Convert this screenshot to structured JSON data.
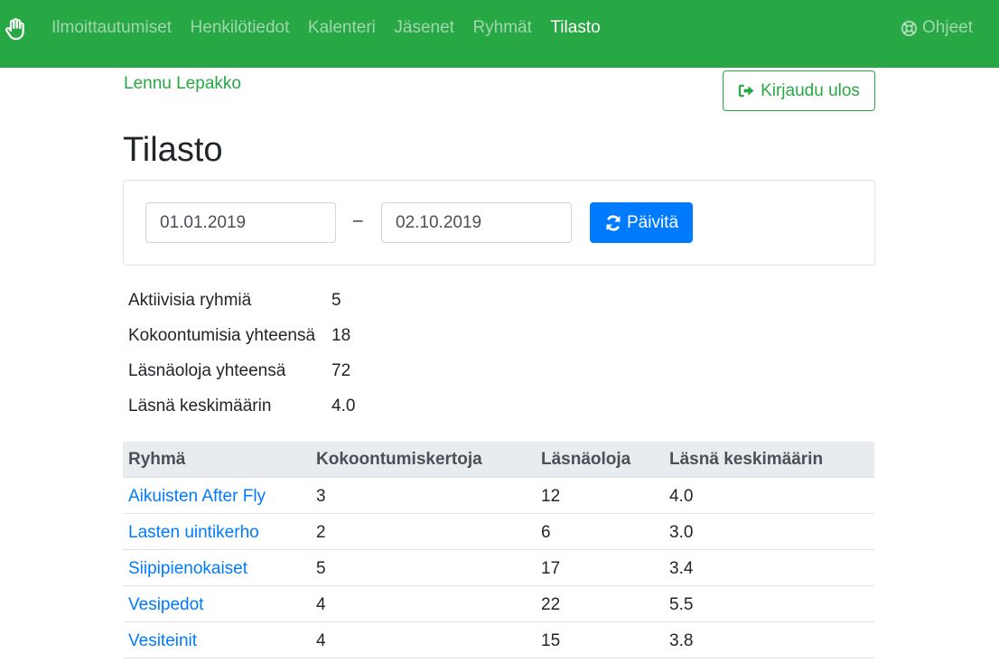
{
  "nav": {
    "brand_icon": "hand-icon",
    "items": [
      {
        "label": "Ilmoittautumiset"
      },
      {
        "label": "Henkilötiedot"
      },
      {
        "label": "Kalenteri"
      },
      {
        "label": "Jäsenet"
      },
      {
        "label": "Ryhmät"
      },
      {
        "label": "Tilasto"
      }
    ],
    "active": "Tilasto",
    "help_label": "Ohjeet",
    "help_icon": "lifebuoy-icon",
    "background_color": "#28a745"
  },
  "user": {
    "name": "Lennu Lepakko"
  },
  "logout": {
    "label": "Kirjaudu ulos",
    "icon": "sign-out-icon"
  },
  "page": {
    "title": "Tilasto"
  },
  "filter": {
    "date_from": "01.01.2019",
    "separator": "–",
    "date_to": "02.10.2019",
    "refresh_label": "Päivitä",
    "refresh_icon": "refresh-icon"
  },
  "summary": [
    {
      "label": "Aktiivisia ryhmiä",
      "value": "5"
    },
    {
      "label": "Kokoontumisia yhteensä",
      "value": "18"
    },
    {
      "label": "Läsnäoloja yhteensä",
      "value": "72"
    },
    {
      "label": "Läsnä keskimäärin",
      "value": "4.0"
    }
  ],
  "table": {
    "headers": [
      "Ryhmä",
      "Kokoontumiskertoja",
      "Läsnäoloja",
      "Läsnä keskimäärin"
    ],
    "rows": [
      [
        "Aikuisten After Fly",
        "3",
        "12",
        "4.0"
      ],
      [
        "Lasten uintikerho",
        "2",
        "6",
        "3.0"
      ],
      [
        "Siipipienokaiset",
        "5",
        "17",
        "3.4"
      ],
      [
        "Vesipedot",
        "4",
        "22",
        "5.5"
      ],
      [
        "Vesiteinit",
        "4",
        "15",
        "3.8"
      ]
    ]
  }
}
